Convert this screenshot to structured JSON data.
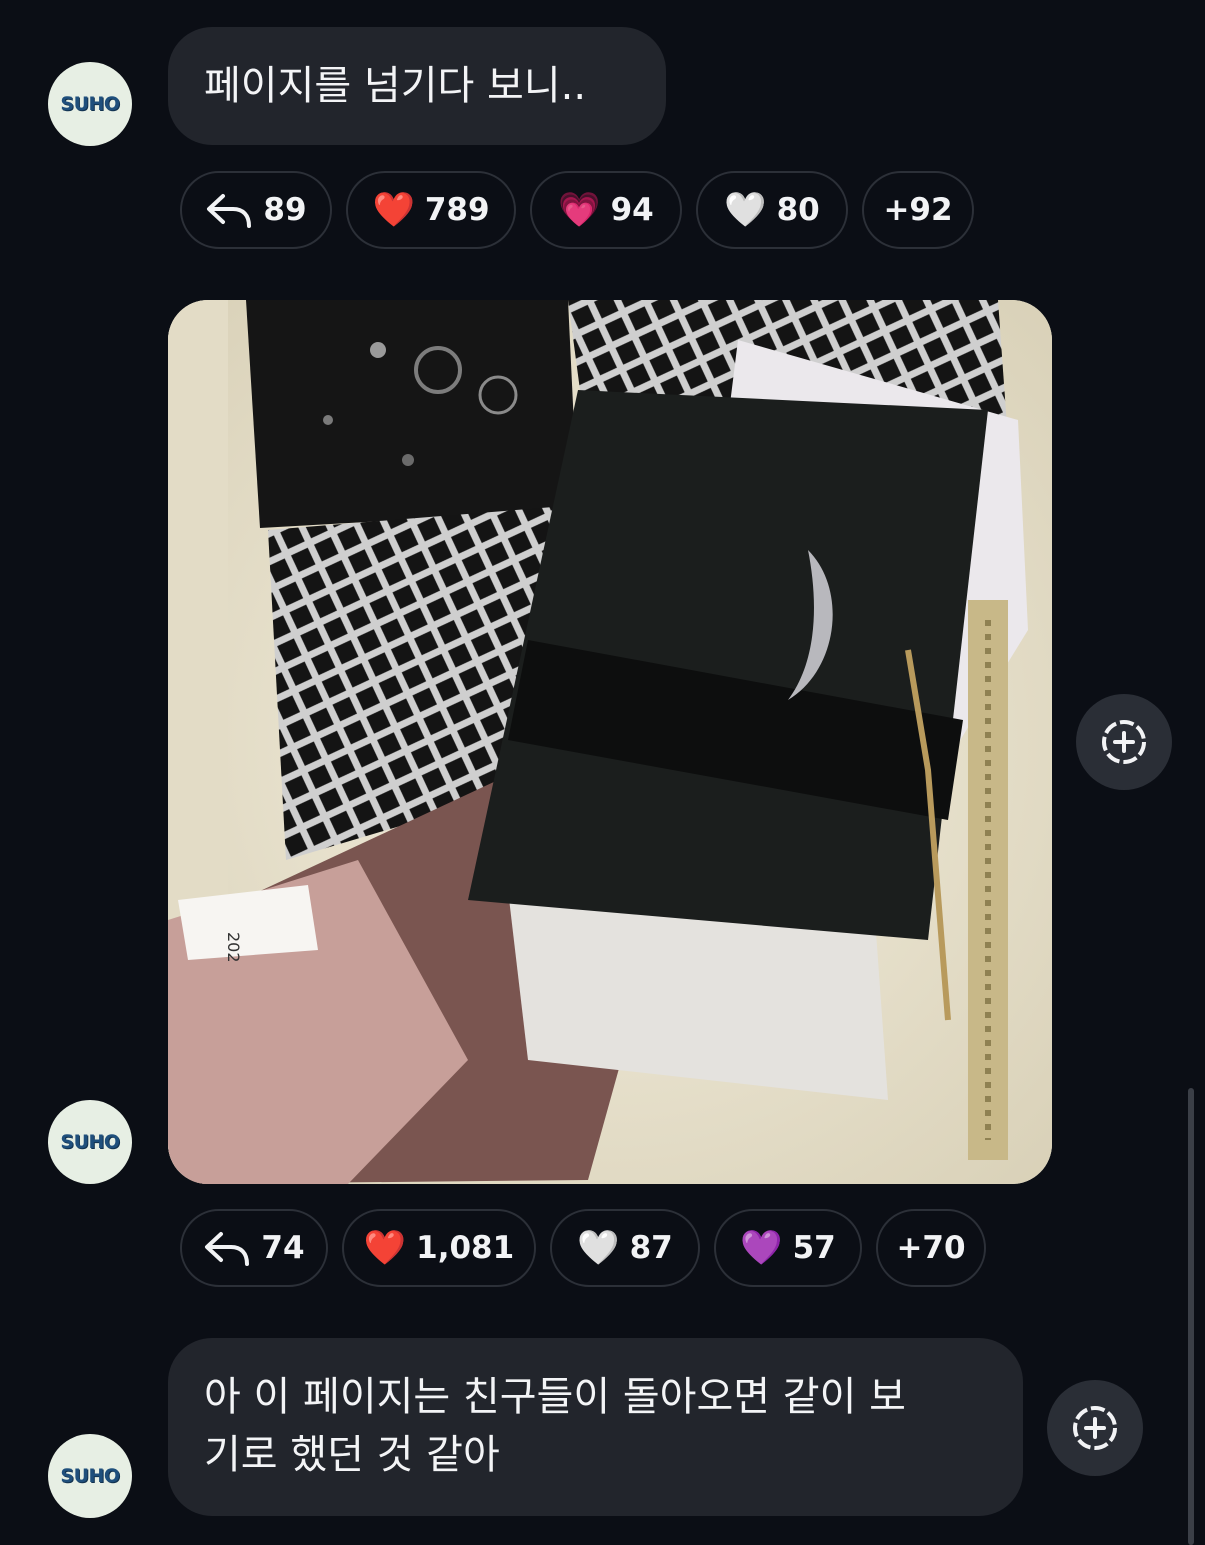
{
  "avatar_label": "SUHO",
  "messages": [
    {
      "text": "페이지를 넘기다 보니..",
      "replies": "89",
      "reactions": [
        {
          "emoji": "❤️",
          "count": "789"
        },
        {
          "emoji": "💗",
          "count": "94"
        },
        {
          "emoji": "🤍",
          "count": "80"
        }
      ],
      "more": "+92"
    },
    {
      "image": "photo of black photocards and envelopes with crosshatch pattern and crescent moon",
      "replies": "74",
      "reactions": [
        {
          "emoji": "❤️",
          "count": "1,081"
        },
        {
          "emoji": "🤍",
          "count": "87"
        },
        {
          "emoji": "💜",
          "count": "57"
        }
      ],
      "more": "+70"
    },
    {
      "text_line1": "아 이 페이지는 친구들이 돌아오면 같이 보",
      "text_line2": "기로 했던 것 같아"
    }
  ],
  "icons": {
    "reply": "reply-arrow-icon",
    "add_reaction": "add-reaction-icon"
  },
  "colors": {
    "background": "#0b0e15",
    "bubble": "#22252c",
    "avatar_bg": "#e7efe4",
    "avatar_text": "#1f4f7c"
  }
}
